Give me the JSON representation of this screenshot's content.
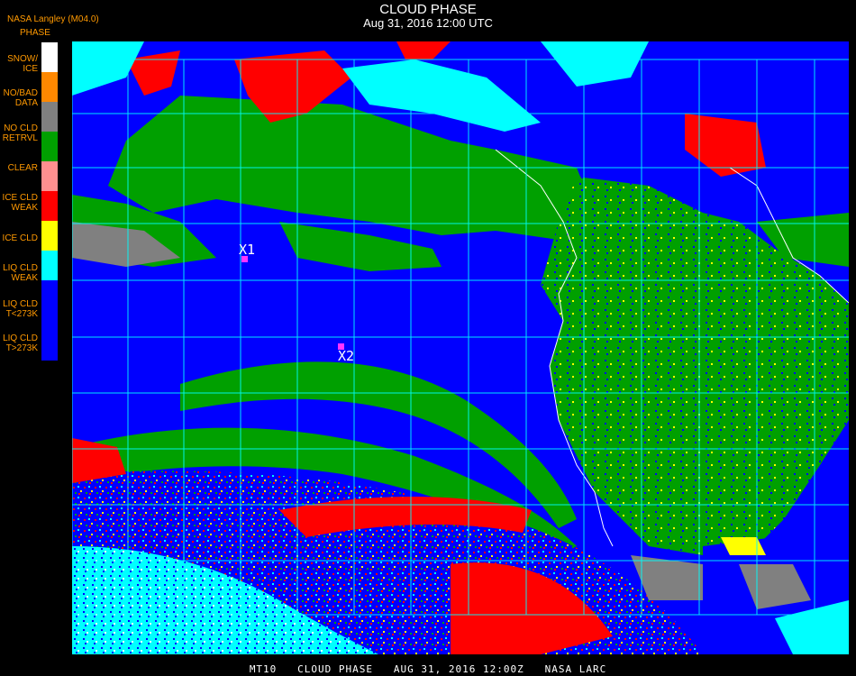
{
  "header": {
    "title": "CLOUD PHASE",
    "date": "Aug 31, 2016 12:00 UTC",
    "provider": "NASA Langley (M04.0)",
    "legend_title": "PHASE"
  },
  "legend": [
    {
      "label": "SNOW/\nICE",
      "color": "#ffffff"
    },
    {
      "label": "NO/BAD\nDATA",
      "color": "#ff8800"
    },
    {
      "label": "NO CLD\nRETRVL",
      "color": "#808080"
    },
    {
      "label": "CLEAR",
      "color": "#00a000"
    },
    {
      "label": "ICE CLD\nWEAK",
      "color": "#ff8f8f"
    },
    {
      "label": "ICE CLD",
      "color": "#ff0000"
    },
    {
      "label": "LIQ CLD\nWEAK",
      "color": "#ffff00"
    },
    {
      "label": "LIQ CLD\nT<273K",
      "color": "#00ffff"
    },
    {
      "label": "LIQ CLD\nT>273K",
      "color": "#0000ff"
    }
  ],
  "markers": [
    {
      "label": "X1"
    },
    {
      "label": "X2"
    }
  ],
  "footer": "MT10   CLOUD PHASE   AUG 31, 2016 12:00Z   NASA LARC",
  "colors": {
    "ocean_liquid": "#0000ff",
    "clear": "#00a000",
    "ice": "#ff0000",
    "cold_liquid": "#00ffff",
    "weak_liquid": "#ffff00",
    "no_retrieval": "#808080",
    "grid": "#00ffff",
    "coast": "#ffffff"
  }
}
